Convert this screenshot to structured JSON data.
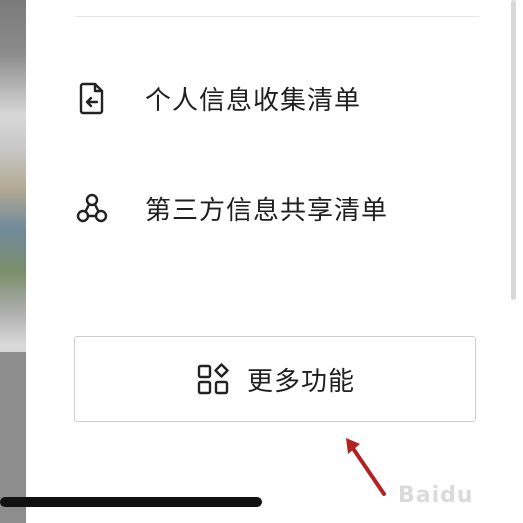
{
  "menu": {
    "items": [
      {
        "label": "个人信息收集清单",
        "icon": "document-return-icon"
      },
      {
        "label": "第三方信息共享清单",
        "icon": "share-nodes-icon"
      }
    ]
  },
  "more_button": {
    "label": "更多功能",
    "icon": "grid-shapes-icon"
  },
  "watermark": "Baidu"
}
